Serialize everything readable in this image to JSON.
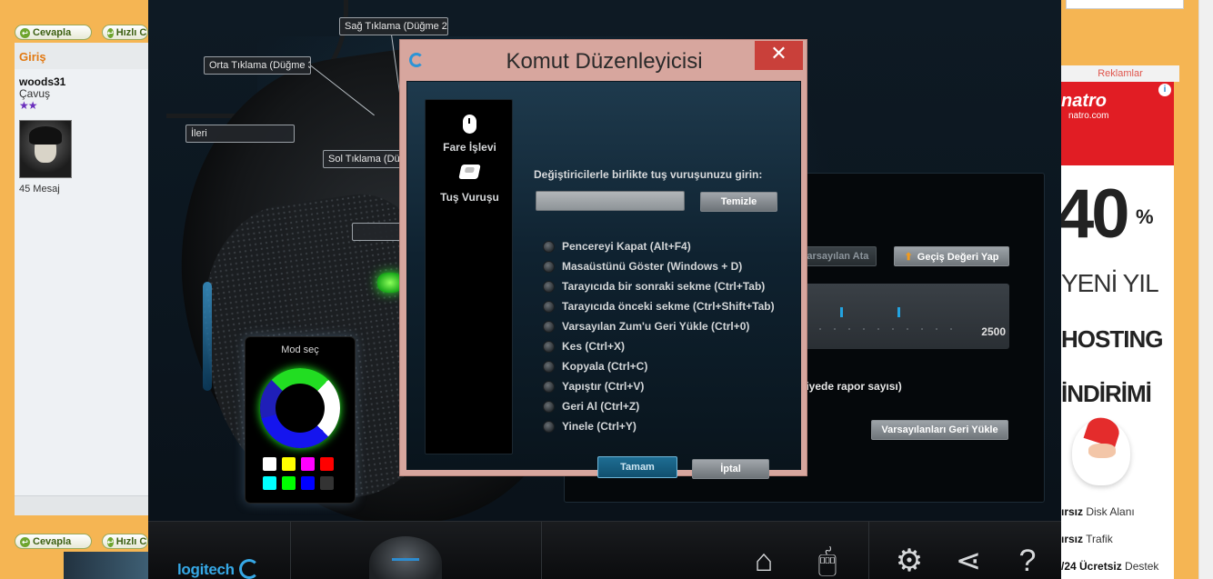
{
  "forum": {
    "reply_label": "Cevapla",
    "quick_reply_label": "Hızlı C",
    "section_title": "Giriş",
    "user": {
      "name": "woods31",
      "rank": "Çavuş",
      "stars": "★★",
      "posts": "45 Mesaj"
    }
  },
  "software": {
    "callouts": {
      "right_click": "Sağ Tıklama (Düğme 2)",
      "middle_click": "Orta Tıklama (Düğme 3)",
      "forward": "İleri",
      "left_click": "Sol Tıklama (Düğ"
    },
    "mode": {
      "title": "Mod seç",
      "swatches": [
        "#ffffff",
        "#ffff00",
        "#ff00ff",
        "#ff0000",
        "#00ffff",
        "#00ff00",
        "#0000ff",
        "#333333"
      ]
    },
    "settings": {
      "default_btn": "Varsayılan Ata",
      "shift_btn": "Geçiş Değeri Yap",
      "dpi_max": "2500",
      "dpi_marks_fraction": [
        0.26,
        0.51
      ],
      "report_rate_label": "niyede rapor sayısı)",
      "restore_btn": "Varsayılanları Geri Yükle"
    },
    "taskbar": {
      "logo": "logitech"
    }
  },
  "dialog": {
    "title": "Komut Düzenleyicisi",
    "close_label": "✕",
    "nav": [
      {
        "label": "Fare İşlevi",
        "icon": "mouse-icon"
      },
      {
        "label": "Tuş Vuruşu",
        "icon": "keystroke-icon"
      }
    ],
    "prompt": "Değiştiricilerle birlikte tuş vuruşunuzu girin:",
    "input_value": "",
    "clear_label": "Temizle",
    "options": [
      "Pencereyi Kapat (Alt+F4)",
      "Masaüstünü Göster (Windows + D)",
      "Tarayıcıda bir sonraki sekme (Ctrl+Tab)",
      "Tarayıcıda önceki sekme (Ctrl+Shift+Tab)",
      "Varsayılan Zum'u Geri Yükle (Ctrl+0)",
      "Kes (Ctrl+X)",
      "Kopyala (Ctrl+C)",
      "Yapıştır (Ctrl+V)",
      "Geri Al (Ctrl+Z)",
      "Yinele (Ctrl+Y)"
    ],
    "ok_label": "Tamam",
    "cancel_label": "İptal"
  },
  "ad": {
    "section_label": "Reklamlar",
    "brand": "natro",
    "brand_url": "natro.com",
    "big_number": "40",
    "percent": "%",
    "line1": "YENİ YIL",
    "line2": "HOSTING",
    "line3": "İNDİRİMİ",
    "perk1_bold": "ırsız",
    "perk1_rest": " Disk Alanı",
    "perk2_bold": "ırsız",
    "perk2_rest": " Trafik",
    "perk3_bold": "/24 Ücretsiz",
    "perk3_rest": " Destek"
  }
}
